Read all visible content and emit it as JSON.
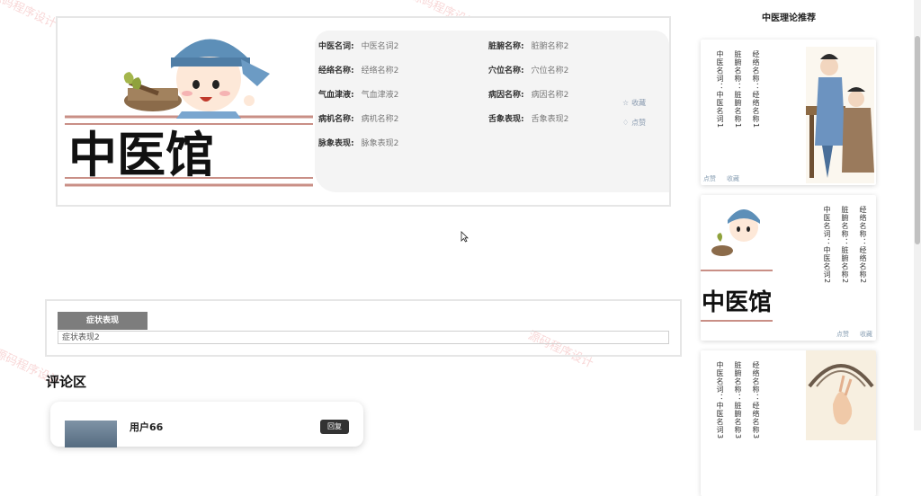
{
  "watermark": "源码程序设计",
  "detail": {
    "fields": [
      {
        "label": "中医名词:",
        "value": "中医名词2"
      },
      {
        "label": "脏腑名称:",
        "value": "脏腑名称2"
      },
      {
        "label": "经络名称:",
        "value": "经络名称2"
      },
      {
        "label": "穴位名称:",
        "value": "穴位名称2"
      },
      {
        "label": "气血津液:",
        "value": "气血津液2"
      },
      {
        "label": "病因名称:",
        "value": "病因名称2"
      },
      {
        "label": "病机名称:",
        "value": "病机名称2"
      },
      {
        "label": "舌象表现:",
        "value": "舌象表现2"
      },
      {
        "label": "脉象表现:",
        "value": "脉象表现2"
      }
    ],
    "collect_label": "收藏",
    "like_label": "点赞",
    "cover_text": "中医馆"
  },
  "symptom": {
    "tab_label": "症状表现",
    "value": "症状表现2"
  },
  "comments": {
    "title": "评论区",
    "items": [
      {
        "user": "用户66",
        "reply_label": "回复"
      }
    ]
  },
  "recommend": {
    "title": "中医理论推荐",
    "cards": [
      {
        "lines": [
          "经络名称：经络名称1",
          "脏腑名称：脏腑名称1",
          "中医名词：中医名词1"
        ],
        "like": "点赞",
        "collect": "收藏"
      },
      {
        "lines": [
          "经络名称：经络名称2",
          "脏腑名称：脏腑名称2",
          "中医名词：中医名词2"
        ],
        "like": "点赞",
        "collect": "收藏",
        "cover_text": "中医馆"
      },
      {
        "lines": [
          "经络名称：经络名称3",
          "脏腑名称：脏腑名称3",
          "中医名词：中医名词3"
        ]
      }
    ]
  },
  "colors": {
    "accent": "#8aa0b4",
    "tab_bg": "#7d7d7d"
  }
}
